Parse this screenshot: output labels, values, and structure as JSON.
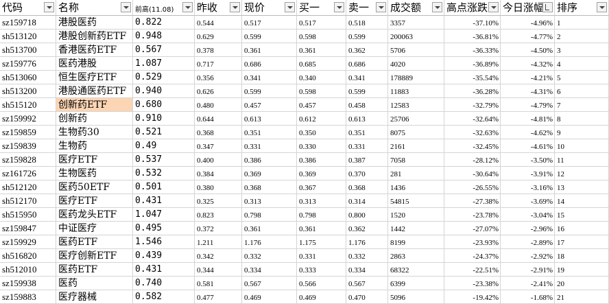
{
  "columns": [
    {
      "key": "code",
      "label": "代码",
      "filter": "dropdown"
    },
    {
      "key": "name",
      "label": "名称",
      "filter": "dropdown"
    },
    {
      "key": "high",
      "label": "前高(11.08)",
      "filter": "dropdown"
    },
    {
      "key": "prev_close",
      "label": "昨收",
      "filter": "dropdown"
    },
    {
      "key": "price",
      "label": "现价",
      "filter": "dropdown"
    },
    {
      "key": "bid1",
      "label": "买一",
      "filter": "dropdown"
    },
    {
      "key": "ask1",
      "label": "卖一",
      "filter": "dropdown"
    },
    {
      "key": "volume",
      "label": "成交额",
      "filter": "dropdown"
    },
    {
      "key": "drawdown",
      "label": "高点涨跌",
      "filter": "dropdown"
    },
    {
      "key": "day_change",
      "label": "今日涨幅",
      "filter": "sorted"
    },
    {
      "key": "rank",
      "label": "排序",
      "filter": "dropdown"
    }
  ],
  "highlight_color": "#fcd5b4",
  "rows": [
    {
      "code": "sz159718",
      "name": "港股医药",
      "high": "0.822",
      "prev_close": "0.544",
      "price": "0.517",
      "bid1": "0.517",
      "ask1": "0.518",
      "volume": "3357",
      "drawdown": "-37.10%",
      "day_change": "-4.96%",
      "rank": "1"
    },
    {
      "code": "sh513120",
      "name": "港股创新药ETF",
      "high": "0.948",
      "prev_close": "0.629",
      "price": "0.599",
      "bid1": "0.598",
      "ask1": "0.599",
      "volume": "200063",
      "drawdown": "-36.81%",
      "day_change": "-4.77%",
      "rank": "2"
    },
    {
      "code": "sh513700",
      "name": "香港医药ETF",
      "high": "0.567",
      "prev_close": "0.378",
      "price": "0.361",
      "bid1": "0.361",
      "ask1": "0.362",
      "volume": "5706",
      "drawdown": "-36.33%",
      "day_change": "-4.50%",
      "rank": "3"
    },
    {
      "code": "sz159776",
      "name": "医药港股",
      "high": "1.087",
      "prev_close": "0.717",
      "price": "0.686",
      "bid1": "0.685",
      "ask1": "0.686",
      "volume": "4020",
      "drawdown": "-36.89%",
      "day_change": "-4.32%",
      "rank": "4"
    },
    {
      "code": "sh513060",
      "name": "恒生医疗ETF",
      "high": "0.529",
      "prev_close": "0.356",
      "price": "0.341",
      "bid1": "0.340",
      "ask1": "0.341",
      "volume": "178889",
      "drawdown": "-35.54%",
      "day_change": "-4.21%",
      "rank": "5"
    },
    {
      "code": "sh513200",
      "name": "港股通医药ETF",
      "high": "0.940",
      "prev_close": "0.626",
      "price": "0.599",
      "bid1": "0.598",
      "ask1": "0.599",
      "volume": "11883",
      "drawdown": "-36.28%",
      "day_change": "-4.31%",
      "rank": "6"
    },
    {
      "code": "sh515120",
      "name": "创新药ETF",
      "high": "0.680",
      "prev_close": "0.480",
      "price": "0.457",
      "bid1": "0.457",
      "ask1": "0.458",
      "volume": "12583",
      "drawdown": "-32.79%",
      "day_change": "-4.79%",
      "rank": "7",
      "highlight": true
    },
    {
      "code": "sz159992",
      "name": "创新药",
      "high": "0.910",
      "prev_close": "0.644",
      "price": "0.613",
      "bid1": "0.612",
      "ask1": "0.613",
      "volume": "25706",
      "drawdown": "-32.64%",
      "day_change": "-4.81%",
      "rank": "8"
    },
    {
      "code": "sz159859",
      "name": "生物药30",
      "high": "0.521",
      "prev_close": "0.368",
      "price": "0.351",
      "bid1": "0.350",
      "ask1": "0.351",
      "volume": "8075",
      "drawdown": "-32.63%",
      "day_change": "-4.62%",
      "rank": "9"
    },
    {
      "code": "sz159839",
      "name": "生物药",
      "high": "0.49",
      "prev_close": "0.347",
      "price": "0.331",
      "bid1": "0.330",
      "ask1": "0.331",
      "volume": "2161",
      "drawdown": "-32.45%",
      "day_change": "-4.61%",
      "rank": "10"
    },
    {
      "code": "sz159828",
      "name": "医疗ETF",
      "high": "0.537",
      "prev_close": "0.400",
      "price": "0.386",
      "bid1": "0.386",
      "ask1": "0.387",
      "volume": "7058",
      "drawdown": "-28.12%",
      "day_change": "-3.50%",
      "rank": "11"
    },
    {
      "code": "sz161726",
      "name": "生物医药",
      "high": "0.532",
      "prev_close": "0.384",
      "price": "0.369",
      "bid1": "0.369",
      "ask1": "0.370",
      "volume": "281",
      "drawdown": "-30.64%",
      "day_change": "-3.91%",
      "rank": "12"
    },
    {
      "code": "sh512120",
      "name": "医药50ETF",
      "high": "0.501",
      "prev_close": "0.380",
      "price": "0.368",
      "bid1": "0.367",
      "ask1": "0.368",
      "volume": "1436",
      "drawdown": "-26.55%",
      "day_change": "-3.16%",
      "rank": "13"
    },
    {
      "code": "sh512170",
      "name": "医疗ETF",
      "high": "0.431",
      "prev_close": "0.325",
      "price": "0.313",
      "bid1": "0.313",
      "ask1": "0.314",
      "volume": "54815",
      "drawdown": "-27.38%",
      "day_change": "-3.69%",
      "rank": "14"
    },
    {
      "code": "sh515950",
      "name": "医药龙头ETF",
      "high": "1.047",
      "prev_close": "0.823",
      "price": "0.798",
      "bid1": "0.798",
      "ask1": "0.800",
      "volume": "1520",
      "drawdown": "-23.78%",
      "day_change": "-3.04%",
      "rank": "15"
    },
    {
      "code": "sz159847",
      "name": "中证医疗",
      "high": "0.495",
      "prev_close": "0.372",
      "price": "0.361",
      "bid1": "0.361",
      "ask1": "0.362",
      "volume": "1442",
      "drawdown": "-27.07%",
      "day_change": "-2.96%",
      "rank": "16"
    },
    {
      "code": "sz159929",
      "name": "医药ETF",
      "high": "1.546",
      "prev_close": "1.211",
      "price": "1.176",
      "bid1": "1.175",
      "ask1": "1.176",
      "volume": "8199",
      "drawdown": "-23.93%",
      "day_change": "-2.89%",
      "rank": "17"
    },
    {
      "code": "sh516820",
      "name": "医疗创新ETF",
      "high": "0.439",
      "prev_close": "0.342",
      "price": "0.332",
      "bid1": "0.331",
      "ask1": "0.332",
      "volume": "2863",
      "drawdown": "-24.37%",
      "day_change": "-2.92%",
      "rank": "18"
    },
    {
      "code": "sh512010",
      "name": "医药ETF",
      "high": "0.431",
      "prev_close": "0.344",
      "price": "0.334",
      "bid1": "0.333",
      "ask1": "0.334",
      "volume": "68322",
      "drawdown": "-22.51%",
      "day_change": "-2.91%",
      "rank": "19"
    },
    {
      "code": "sz159938",
      "name": "医药",
      "high": "0.740",
      "prev_close": "0.581",
      "price": "0.567",
      "bid1": "0.566",
      "ask1": "0.567",
      "volume": "6399",
      "drawdown": "-23.38%",
      "day_change": "-2.41%",
      "rank": "20"
    },
    {
      "code": "sz159883",
      "name": "医疗器械",
      "high": "0.582",
      "prev_close": "0.477",
      "price": "0.469",
      "bid1": "0.469",
      "ask1": "0.470",
      "volume": "5096",
      "drawdown": "-19.42%",
      "day_change": "-1.68%",
      "rank": "21"
    }
  ]
}
